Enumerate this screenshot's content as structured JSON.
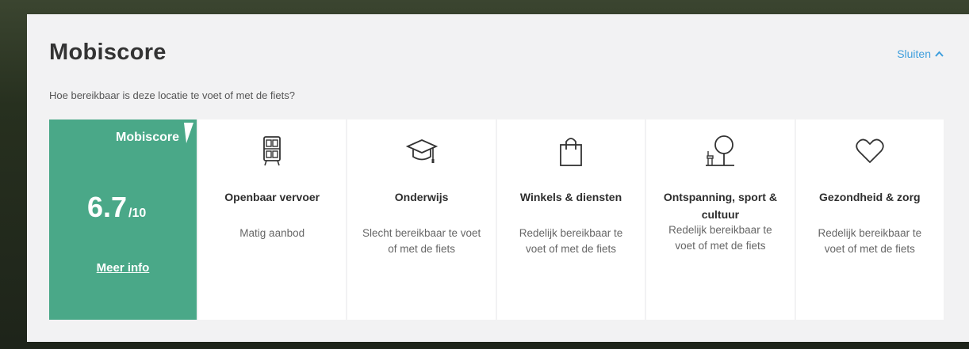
{
  "panel": {
    "title": "Mobiscore",
    "close_label": "Sluiten",
    "subtitle": "Hoe bereikbaar is deze locatie te voet of met de fiets?"
  },
  "score": {
    "label": "Mobiscore",
    "value": "6.7",
    "max": "/10",
    "more_info": "Meer info",
    "color": "#4aa888"
  },
  "categories": [
    {
      "title": "Openbaar vervoer",
      "description": "Matig aanbod",
      "icon": "tram-icon"
    },
    {
      "title": "Onderwijs",
      "description": "Slecht bereikbaar te voet of met de fiets",
      "icon": "graduation-cap-icon"
    },
    {
      "title": "Winkels & diensten",
      "description": "Redelijk bereikbaar te voet of met de fiets",
      "icon": "shopping-bag-icon"
    },
    {
      "title": "Ontspanning, sport & cultuur",
      "description": "Redelijk bereikbaar te voet of met de fiets",
      "icon": "tree-bench-icon"
    },
    {
      "title": "Gezondheid & zorg",
      "description": "Redelijk bereikbaar te voet of met de fiets",
      "icon": "heart-icon"
    }
  ],
  "colors": {
    "accent_link": "#3f9fdd",
    "panel_bg": "#f2f2f3"
  }
}
